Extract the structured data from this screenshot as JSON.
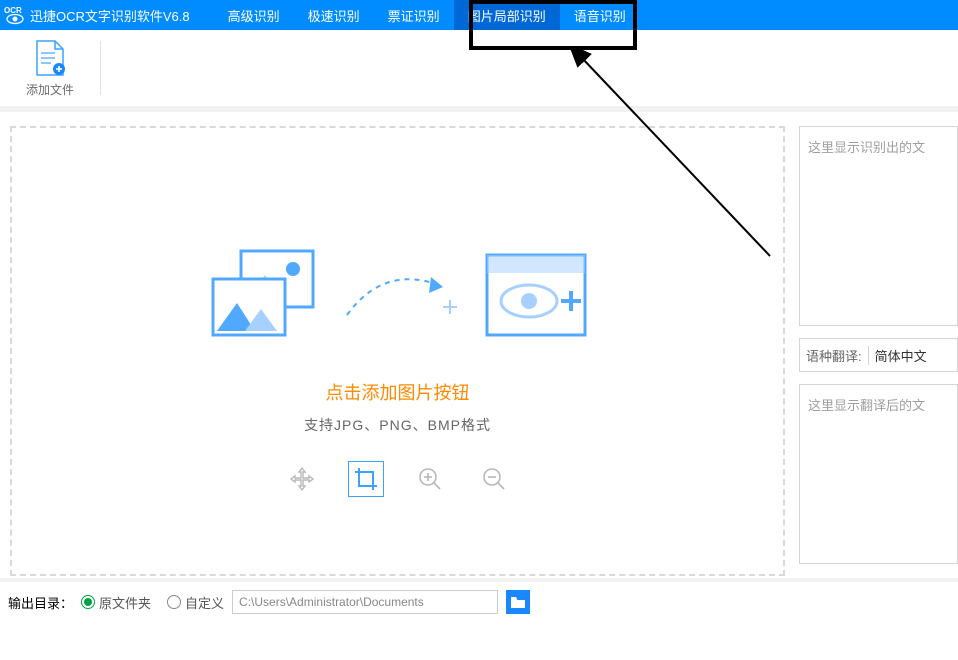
{
  "app_title": "迅捷OCR文字识别软件V6.8",
  "menu": [
    {
      "label": "高级识别",
      "active": false
    },
    {
      "label": "极速识别",
      "active": false
    },
    {
      "label": "票证识别",
      "active": false
    },
    {
      "label": "图片局部识别",
      "active": true
    },
    {
      "label": "语音识别",
      "active": false
    }
  ],
  "toolbar": {
    "add_file": "添加文件"
  },
  "canvas": {
    "title": "点击添加图片按钮",
    "subtitle": "支持JPG、PNG、BMP格式"
  },
  "right": {
    "result_placeholder": "这里显示识别出的文",
    "lang_label": "语种翻译:",
    "lang_value": "简体中文",
    "translate_placeholder": "这里显示翻译后的文"
  },
  "footer": {
    "output_label": "输出目录：",
    "radio_original": "原文件夹",
    "radio_custom": "自定义",
    "path": "C:\\Users\\Administrator\\Documents"
  }
}
